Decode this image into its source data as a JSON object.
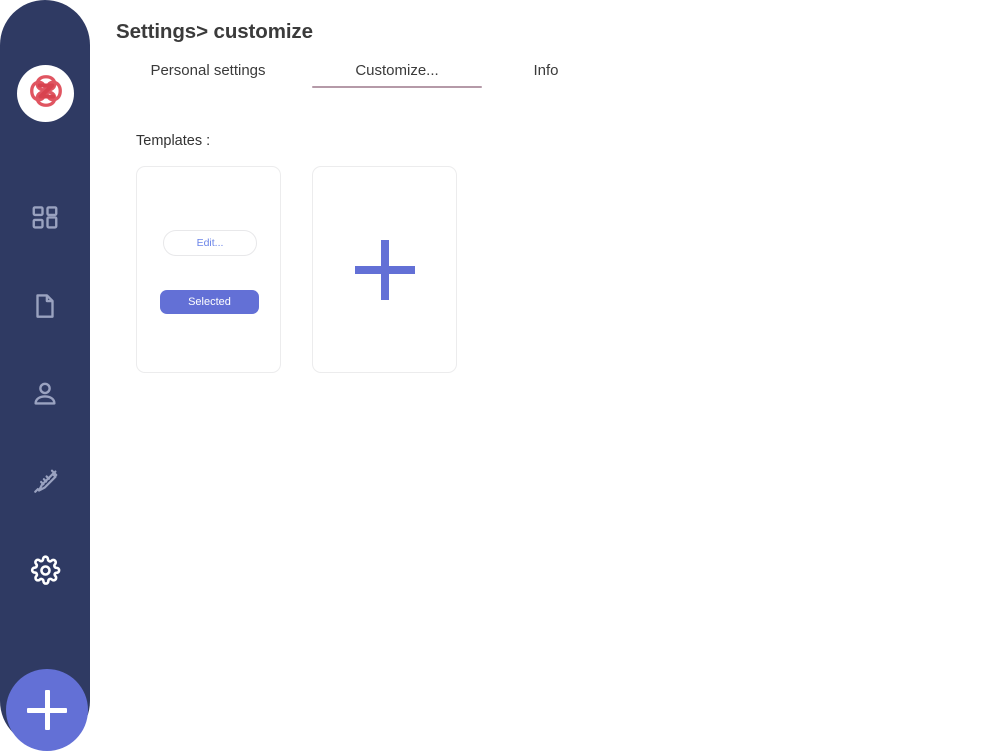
{
  "colors": {
    "sidebar_bg": "#2f3a63",
    "accent_purple": "#6370d6",
    "edit_text": "#6b84e8",
    "tab_underline": "#b59aa8",
    "logo_red": "#e05561",
    "icon_inactive": "#9aa2c0",
    "icon_active": "#ffffff",
    "card_border": "#ececed"
  },
  "sidebar": {
    "logo": {
      "icon": "interlocking-knot-logo",
      "label": "App logo"
    },
    "items": [
      {
        "icon": "dashboard-grid-icon",
        "label": "Dashboard",
        "active": false
      },
      {
        "icon": "document-icon",
        "label": "Documents",
        "active": false
      },
      {
        "icon": "person-icon",
        "label": "Patients",
        "active": false
      },
      {
        "icon": "syringe-icon",
        "label": "Treatments",
        "active": false
      },
      {
        "icon": "gear-icon",
        "label": "Settings",
        "active": true
      }
    ],
    "fab": {
      "icon": "plus-icon",
      "label": "Add"
    }
  },
  "header": {
    "breadcrumb": "Settings> customize"
  },
  "tabs": [
    {
      "label": "Personal settings",
      "active": false
    },
    {
      "label": "Customize...",
      "active": true
    },
    {
      "label": "Info",
      "active": false
    }
  ],
  "main": {
    "templates_label": "Templates :",
    "cards": [
      {
        "type": "template",
        "edit_label": "Edit...",
        "selected_label": "Selected"
      },
      {
        "type": "add",
        "icon": "plus-icon"
      }
    ]
  }
}
